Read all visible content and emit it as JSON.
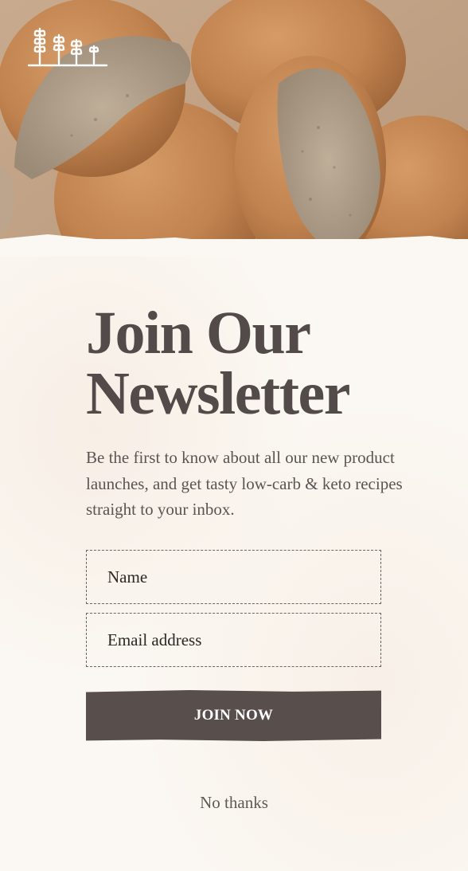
{
  "hero": {
    "image_name": "bread-rolls-photo",
    "logo_icon": "wheat-stalks-logo-icon"
  },
  "newsletter": {
    "title_line1": "Join Our",
    "title_line2": "Newsletter",
    "description": "Be the first to know about all our new product launches, and get tasty low-carb & keto recipes straight to your inbox.",
    "name_placeholder": "Name",
    "email_placeholder": "Email address",
    "join_label": "JOIN NOW",
    "dismiss_label": "No thanks"
  },
  "colors": {
    "panel_background": "#fbf7f2",
    "heading_text": "#534b49",
    "button_background": "#584f4c",
    "button_text": "#ffffff"
  }
}
